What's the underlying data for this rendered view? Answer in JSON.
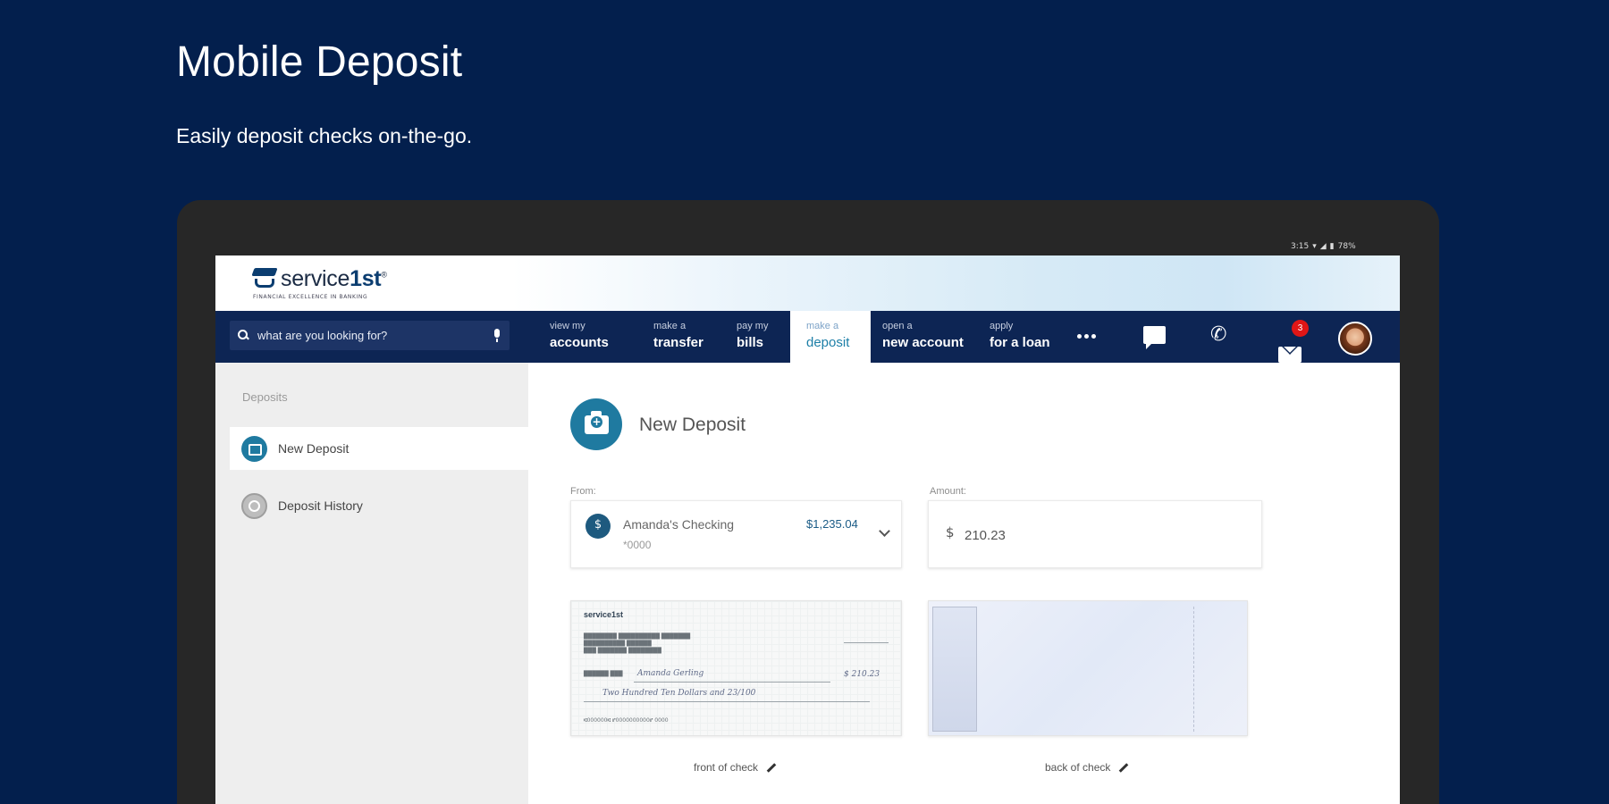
{
  "page": {
    "headline": "Mobile Deposit",
    "subhead": "Easily deposit checks on-the-go."
  },
  "status_bar": {
    "time": "3:15",
    "battery": "78%"
  },
  "brand": {
    "logo_text_prefix": "service",
    "logo_text_accent": "1st",
    "logo_mark": "®",
    "tagline": "FINANCIAL EXCELLENCE IN BANKING"
  },
  "nav": {
    "search_placeholder": "what are you looking for?",
    "items": [
      {
        "small": "view my",
        "big": "accounts"
      },
      {
        "small": "make a",
        "big": "transfer"
      },
      {
        "small": "pay my",
        "big": "bills"
      },
      {
        "small": "make a",
        "big": "deposit"
      },
      {
        "small": "open a",
        "big": "new account"
      },
      {
        "small": "apply",
        "big": "for a loan"
      }
    ],
    "active_item": "deposit",
    "more_icon": "more-dots-icon",
    "chat_icon": "chat-icon",
    "phone_icon": "phone-icon",
    "mail_icon": "mail-icon",
    "mail_badge": "3",
    "avatar_icon": "user-avatar"
  },
  "sidebar": {
    "heading": "Deposits",
    "items": [
      {
        "label": "New Deposit",
        "icon": "deposit-icon",
        "active": true
      },
      {
        "label": "Deposit History",
        "icon": "history-icon",
        "active": false
      }
    ]
  },
  "main": {
    "title": "New Deposit",
    "title_icon": "camera-plus-icon",
    "from_label": "From:",
    "account": {
      "name": "Amanda's Checking",
      "number": "*0000",
      "balance": "$1,235.04"
    },
    "amount_label": "Amount:",
    "amount_currency": "$",
    "amount_value": "210.23",
    "front_caption": "front of check",
    "back_caption": "back of check",
    "check_front": {
      "logo": "service1st",
      "payee": "Amanda Gerling",
      "written_amount": "Two Hundred Ten Dollars and 23/100",
      "numeric_amount": "$ 210.23"
    }
  },
  "colors": {
    "background": "#031f4d",
    "nav": "#0d2554",
    "accent": "#1f7aa0",
    "badge": "#e01616"
  }
}
